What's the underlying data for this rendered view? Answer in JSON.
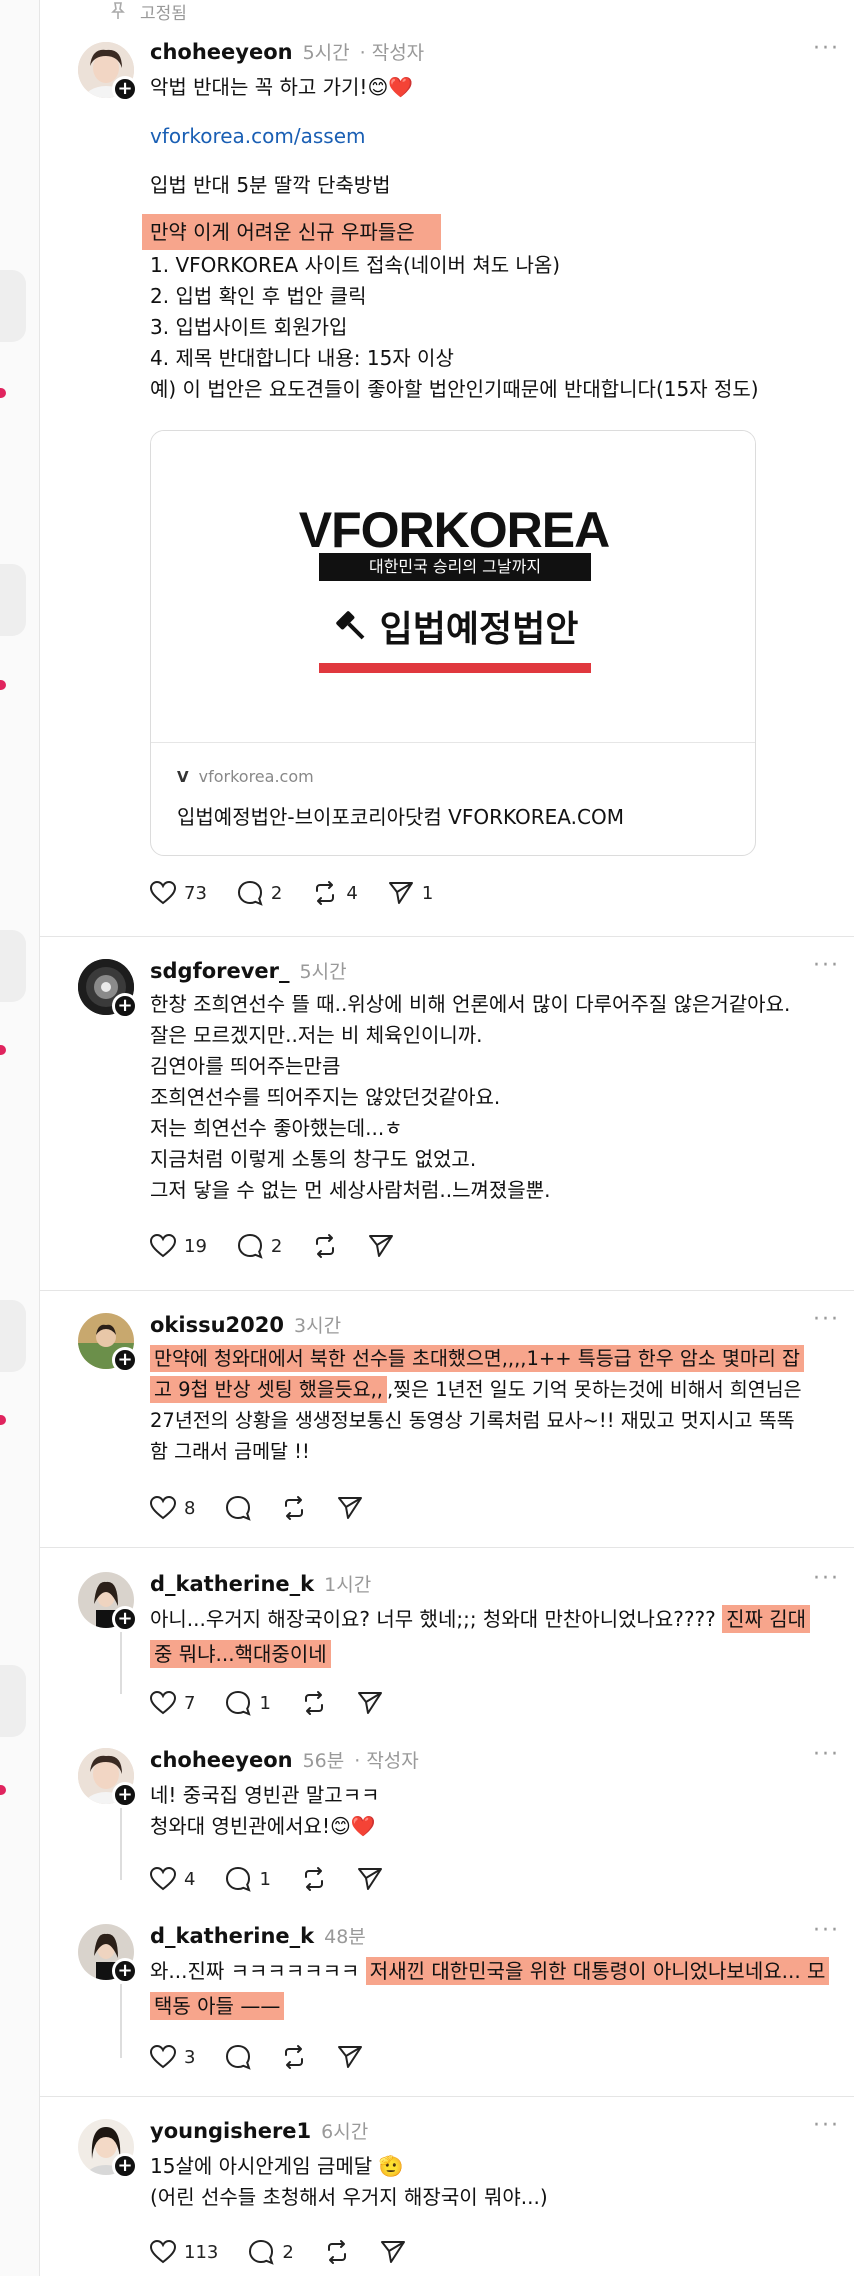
{
  "pinned_label": "고정됨",
  "posts": [
    {
      "username": "choheeyeon",
      "time": "5시간",
      "author_badge": "· 작성자",
      "line1": "악법 반대는 꼭 하고 가기!😊❤️",
      "link": "vforkorea.com/assem",
      "line2": "입법 반대 5분 딸깍 단축방법",
      "highlight": "만약 이게 어려운 신규 우파들은",
      "steps": [
        "1. VFORKOREA 사이트 접속(네이버 쳐도 나옴)",
        "2. 입법 확인 후 법안 클릭",
        "3. 입법사이트 회원가입",
        "4. 제목 반대합니다 내용: 15자 이상",
        "예) 이 법안은 요도견들이 좋아할 법안인기때문에 반대합니다(15자 정도)"
      ],
      "card": {
        "brand": "VFORKOREA",
        "tagline": "대한민국 승리의 그날까지",
        "headline": "입법예정법안",
        "domain_logo": "V",
        "domain": "vforkorea.com",
        "title": "입법예정법안-브이포코리아닷컴 VFORKOREA.COM"
      },
      "likes": "73",
      "replies": "2",
      "reposts": "4",
      "shares": "1"
    },
    {
      "username": "sdgforever_",
      "time": "5시간",
      "lines": [
        "한창 조희연선수 뜰 때..위상에 비해 언론에서 많이 다루어주질 않은거같아요.",
        "잘은 모르겠지만..저는 비 체육인이니까.",
        "김연아를 띄어주는만큼",
        "조희연선수를 띄어주지는 않았던것같아요.",
        "저는 희연선수 좋아했는데...ㅎ",
        "지금처럼 이렇게 소통의 창구도 없었고.",
        "그저 닿을 수 없는 먼 세상사람처럼..느껴졌을뿐."
      ],
      "likes": "19",
      "replies": "2"
    },
    {
      "username": "okissu2020",
      "time": "3시간",
      "hl1": "만약에 청와대에서 북한 선수들 초대했으면,,,,1++ 특등급 한우 암소 몇마리 잡",
      "hl2": "고 9첩 반상 셋팅 했을듯요,,",
      "rest2": ",찢은 1년전 일도 기억 못하는것에 비해서 희연님은",
      "line3": "27년전의 상황을 생생정보통신 동영상 기록처럼 묘사~!! 재밌고 멋지시고 똑똑",
      "line4": "함 그래서 금메달 !!",
      "likes": "8"
    },
    {
      "username": "d_katherine_k",
      "time": "1시간",
      "text1": "아니...우거지 해장국이요? 너무 했네;;; 청와대 만찬아니었나요???? ",
      "hl1": "진짜 김대",
      "hl2": "중 뭐냐...핵대중이네",
      "likes": "7",
      "replies": "1"
    },
    {
      "username": "choheeyeon",
      "time": "56분",
      "author_badge": "· 작성자",
      "lines": [
        "네! 중국집 영빈관 말고ㅋㅋ",
        "청와대 영빈관에서요!😊❤️"
      ],
      "likes": "4",
      "replies": "1"
    },
    {
      "username": "d_katherine_k",
      "time": "48분",
      "text1": "와...진짜 ㅋㅋㅋㅋㅋㅋㅋ ",
      "hl1": "저새낀 대한민국을 위한 대통령이 아니었나보네요... 모",
      "hl2": "택동 아들 ——",
      "likes": "3"
    },
    {
      "username": "youngishere1",
      "time": "6시간",
      "lines": [
        "15살에 아시안게임 금메달 🫡",
        "(어린 선수들 초청해서 우거지 해장국이 뭐야...)"
      ],
      "likes": "113",
      "replies": "2"
    }
  ]
}
